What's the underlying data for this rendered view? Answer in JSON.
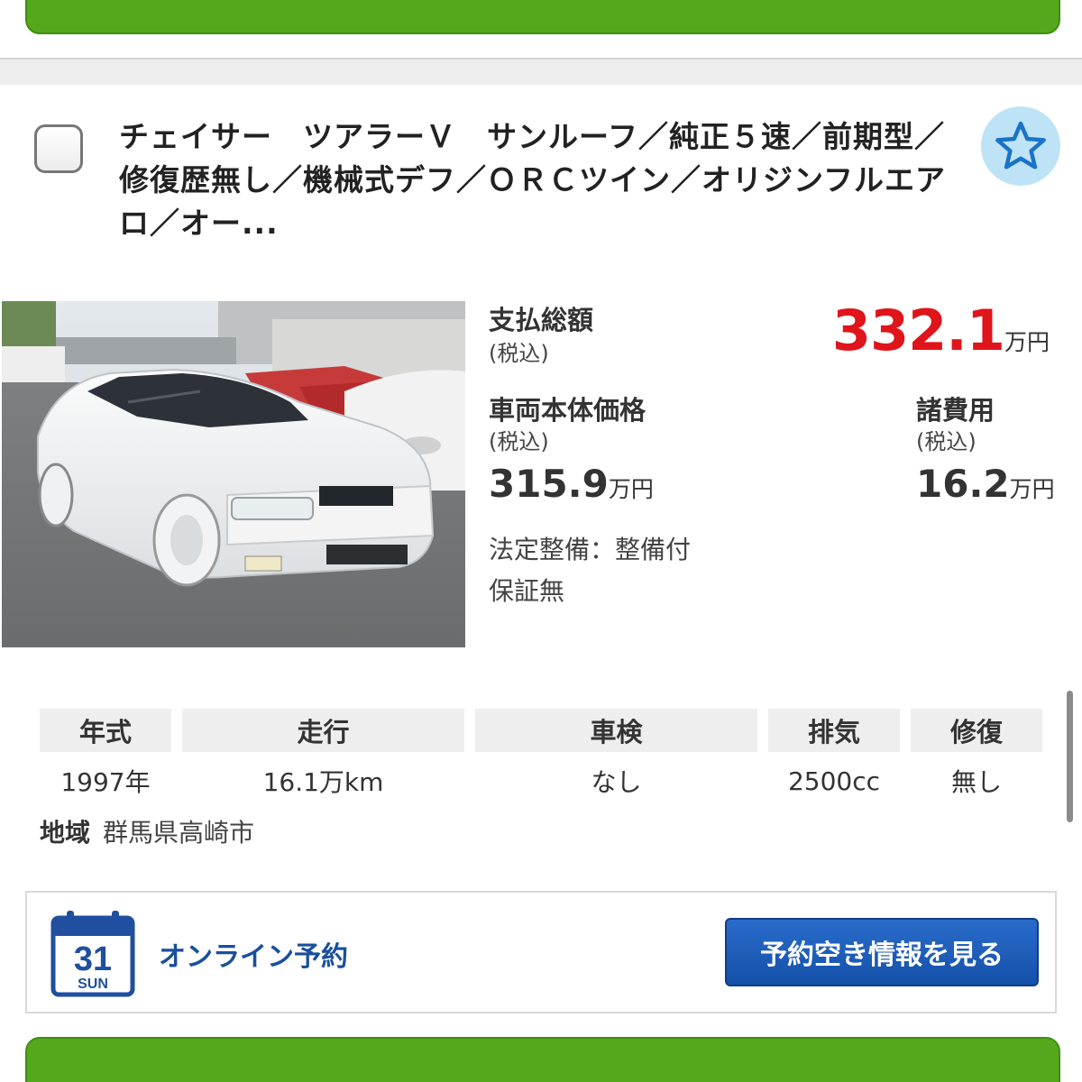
{
  "listing": {
    "title": "チェイサー　ツアラーＶ　サンルーフ／純正５速／前期型／修復歴無し／機械式デフ／ＯＲＣツイン／オリジンフルエアロ／オー..."
  },
  "pricing": {
    "total_label": "支払総額",
    "total_sub": "(税込)",
    "total_value": "332.1",
    "total_unit": "万円",
    "body_label": "車両本体価格",
    "body_sub": "(税込)",
    "body_value": "315.9",
    "body_unit": "万円",
    "fee_label": "諸費用",
    "fee_sub": "(税込)",
    "fee_value": "16.2",
    "fee_unit": "万円",
    "inspection_note": "法定整備：整備付",
    "warranty_note": "保証無"
  },
  "specs": {
    "headers": [
      "年式",
      "走行",
      "車検",
      "排気",
      "修復"
    ],
    "values": [
      "1997年",
      "16.1万km",
      "なし",
      "2500cc",
      "無し"
    ]
  },
  "region": {
    "label": "地域",
    "value": "群馬県高崎市"
  },
  "reservation": {
    "calendar_day": "31",
    "calendar_weekday": "SUN",
    "label": "オンライン予約",
    "button": "予約空き情報を見る"
  },
  "colors": {
    "price_red": "#e0141b",
    "green_button": "#55a81c",
    "blue_button": "#1a5fc0",
    "star_bg": "#bfe3f6",
    "star": "#1a73c9"
  },
  "icons": {
    "favorite": "star-icon",
    "calendar": "calendar-icon"
  }
}
